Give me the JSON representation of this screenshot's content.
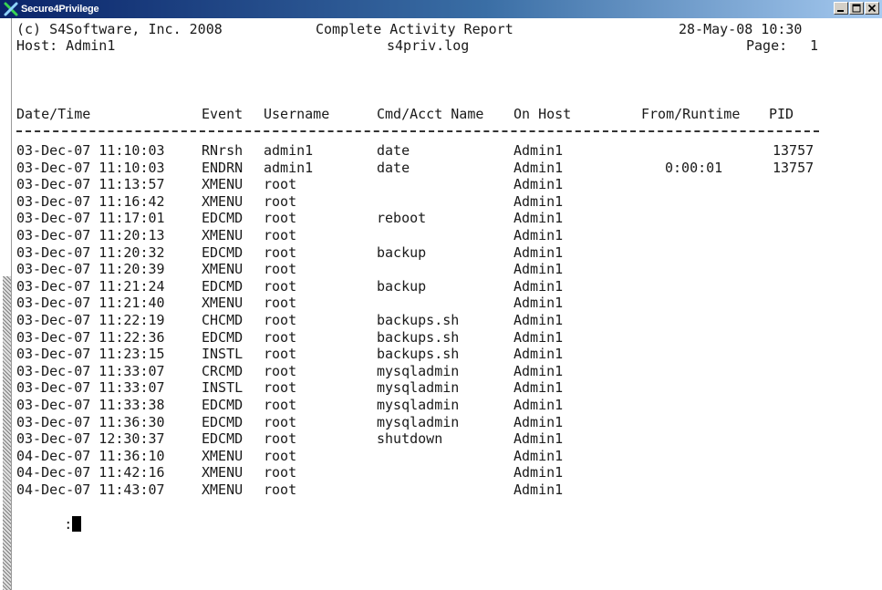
{
  "window": {
    "title": "Secure4Privilege",
    "controls": [
      "minimize-button",
      "maximize-button",
      "close-button"
    ]
  },
  "report": {
    "copyright": "(c) S4Software, Inc. 2008",
    "title": "Complete Activity Report",
    "datetime": "28-May-08 10:30",
    "host_label": "Host: Admin1",
    "logfile": "s4priv.log",
    "page_label": "Page:",
    "page_number": "1"
  },
  "table": {
    "headers": {
      "datetime": "Date/Time",
      "event": "Event",
      "username": "Username",
      "cmd": "Cmd/Acct Name",
      "host": "On Host",
      "from": "From/Runtime",
      "pid": "PID"
    },
    "rows": [
      {
        "datetime": "03-Dec-07 11:10:03",
        "event": "RNrsh",
        "username": "admin1",
        "cmd": "date",
        "host": "Admin1",
        "from": "",
        "pid": "13757"
      },
      {
        "datetime": "03-Dec-07 11:10:03",
        "event": "ENDRN",
        "username": "admin1",
        "cmd": "date",
        "host": "Admin1",
        "from": "0:00:01",
        "pid": "13757"
      },
      {
        "datetime": "03-Dec-07 11:13:57",
        "event": "XMENU",
        "username": "root",
        "cmd": "",
        "host": "Admin1",
        "from": "",
        "pid": ""
      },
      {
        "datetime": "03-Dec-07 11:16:42",
        "event": "XMENU",
        "username": "root",
        "cmd": "",
        "host": "Admin1",
        "from": "",
        "pid": ""
      },
      {
        "datetime": "03-Dec-07 11:17:01",
        "event": "EDCMD",
        "username": "root",
        "cmd": "reboot",
        "host": "Admin1",
        "from": "",
        "pid": ""
      },
      {
        "datetime": "03-Dec-07 11:20:13",
        "event": "XMENU",
        "username": "root",
        "cmd": "",
        "host": "Admin1",
        "from": "",
        "pid": ""
      },
      {
        "datetime": "03-Dec-07 11:20:32",
        "event": "EDCMD",
        "username": "root",
        "cmd": "backup",
        "host": "Admin1",
        "from": "",
        "pid": ""
      },
      {
        "datetime": "03-Dec-07 11:20:39",
        "event": "XMENU",
        "username": "root",
        "cmd": "",
        "host": "Admin1",
        "from": "",
        "pid": ""
      },
      {
        "datetime": "03-Dec-07 11:21:24",
        "event": "EDCMD",
        "username": "root",
        "cmd": "backup",
        "host": "Admin1",
        "from": "",
        "pid": ""
      },
      {
        "datetime": "03-Dec-07 11:21:40",
        "event": "XMENU",
        "username": "root",
        "cmd": "",
        "host": "Admin1",
        "from": "",
        "pid": ""
      },
      {
        "datetime": "03-Dec-07 11:22:19",
        "event": "CHCMD",
        "username": "root",
        "cmd": "backups.sh",
        "host": "Admin1",
        "from": "",
        "pid": ""
      },
      {
        "datetime": "03-Dec-07 11:22:36",
        "event": "EDCMD",
        "username": "root",
        "cmd": "backups.sh",
        "host": "Admin1",
        "from": "",
        "pid": ""
      },
      {
        "datetime": "03-Dec-07 11:23:15",
        "event": "INSTL",
        "username": "root",
        "cmd": "backups.sh",
        "host": "Admin1",
        "from": "",
        "pid": ""
      },
      {
        "datetime": "03-Dec-07 11:33:07",
        "event": "CRCMD",
        "username": "root",
        "cmd": "mysqladmin",
        "host": "Admin1",
        "from": "",
        "pid": ""
      },
      {
        "datetime": "03-Dec-07 11:33:07",
        "event": "INSTL",
        "username": "root",
        "cmd": "mysqladmin",
        "host": "Admin1",
        "from": "",
        "pid": ""
      },
      {
        "datetime": "03-Dec-07 11:33:38",
        "event": "EDCMD",
        "username": "root",
        "cmd": "mysqladmin",
        "host": "Admin1",
        "from": "",
        "pid": ""
      },
      {
        "datetime": "03-Dec-07 11:36:30",
        "event": "EDCMD",
        "username": "root",
        "cmd": "mysqladmin",
        "host": "Admin1",
        "from": "",
        "pid": ""
      },
      {
        "datetime": "03-Dec-07 12:30:37",
        "event": "EDCMD",
        "username": "root",
        "cmd": "shutdown",
        "host": "Admin1",
        "from": "",
        "pid": ""
      },
      {
        "datetime": "04-Dec-07 11:36:10",
        "event": "XMENU",
        "username": "root",
        "cmd": "",
        "host": "Admin1",
        "from": "",
        "pid": ""
      },
      {
        "datetime": "04-Dec-07 11:42:16",
        "event": "XMENU",
        "username": "root",
        "cmd": "",
        "host": "Admin1",
        "from": "",
        "pid": ""
      },
      {
        "datetime": "04-Dec-07 11:43:07",
        "event": "XMENU",
        "username": "root",
        "cmd": "",
        "host": "Admin1",
        "from": "",
        "pid": ""
      }
    ]
  },
  "prompt": {
    "text": ":"
  },
  "colors": {
    "titlebar_start": "#0a246a",
    "titlebar_end": "#a6caf0",
    "terminal_bg": "#ffffff",
    "terminal_text": "#1a1a1a"
  }
}
